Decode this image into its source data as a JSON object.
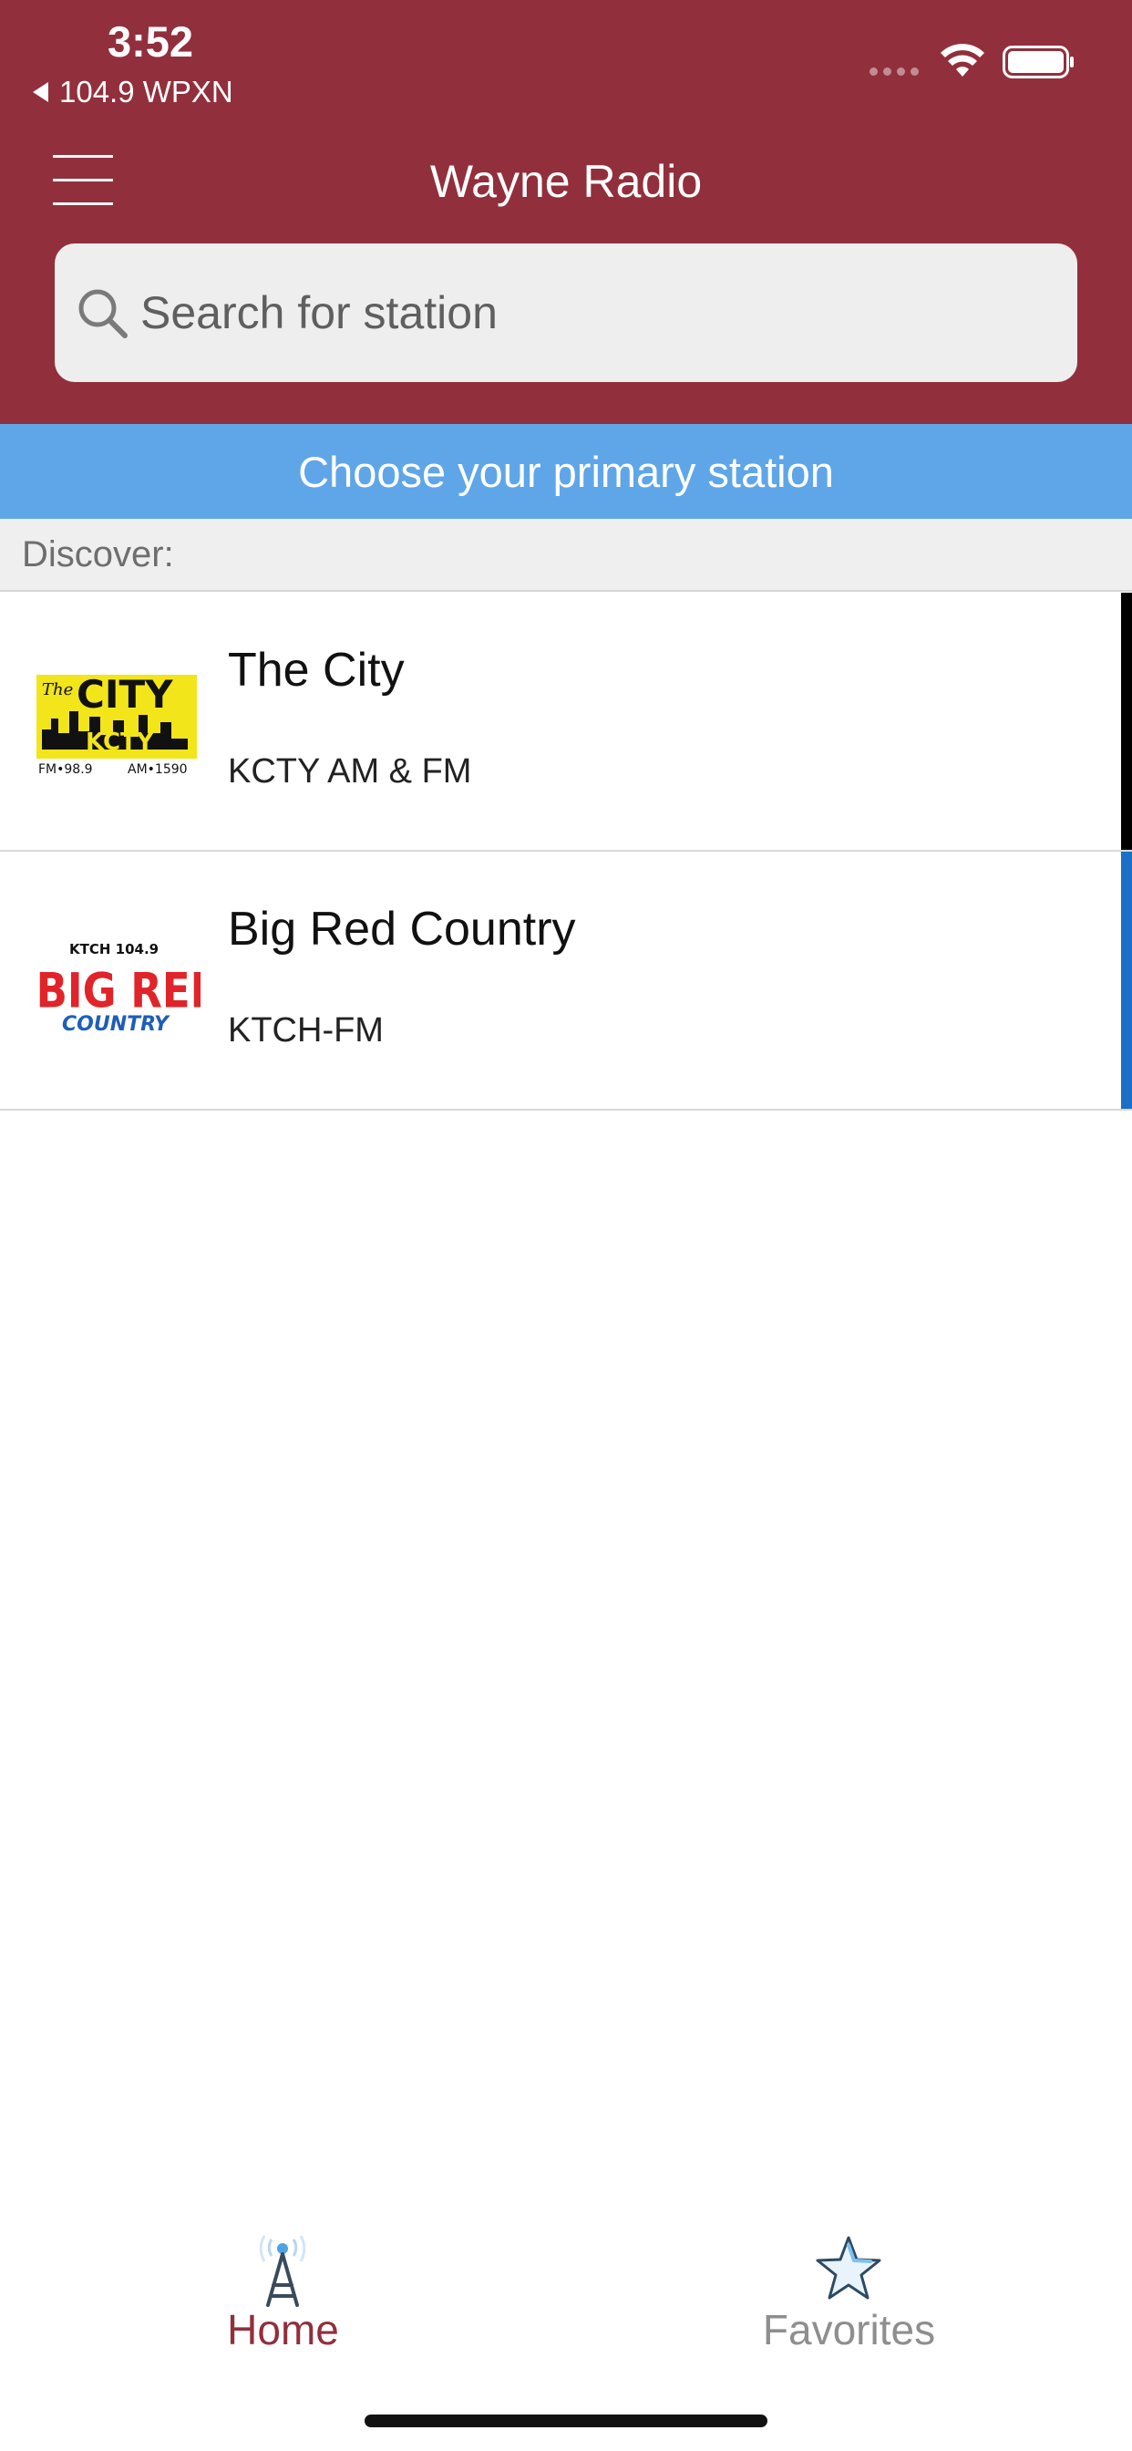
{
  "status_bar": {
    "time": "3:52",
    "back_app": "104.9 WPXN",
    "icons": [
      "signal-dots-icon",
      "wifi-icon",
      "battery-icon"
    ]
  },
  "header": {
    "title": "Wayne Radio",
    "menu_icon": "hamburger-menu-icon",
    "background_color": "#922f3c"
  },
  "search": {
    "placeholder": "Search for station",
    "icon": "search-icon"
  },
  "banner": {
    "text": "Choose your primary station",
    "color": "#5fa6e8"
  },
  "discover": {
    "label": "Discover:"
  },
  "stations": [
    {
      "name": "The City",
      "call_sign": "KCTY AM & FM",
      "logo_text": [
        "The",
        "CITY",
        "KCTY",
        "FM•98.9",
        "AM•1590"
      ],
      "accent_color": "#000000"
    },
    {
      "name": "Big Red Country",
      "call_sign": "KTCH-FM",
      "logo_text": [
        "KTCH 104.9",
        "BIG RED",
        "COUNTRY"
      ],
      "accent_color": "#1a6fc7"
    }
  ],
  "tabs": [
    {
      "label": "Home",
      "icon": "radio-tower-icon",
      "active": true,
      "color": "#922f3c"
    },
    {
      "label": "Favorites",
      "icon": "star-icon",
      "active": false,
      "color": "#8e8e8e"
    }
  ]
}
